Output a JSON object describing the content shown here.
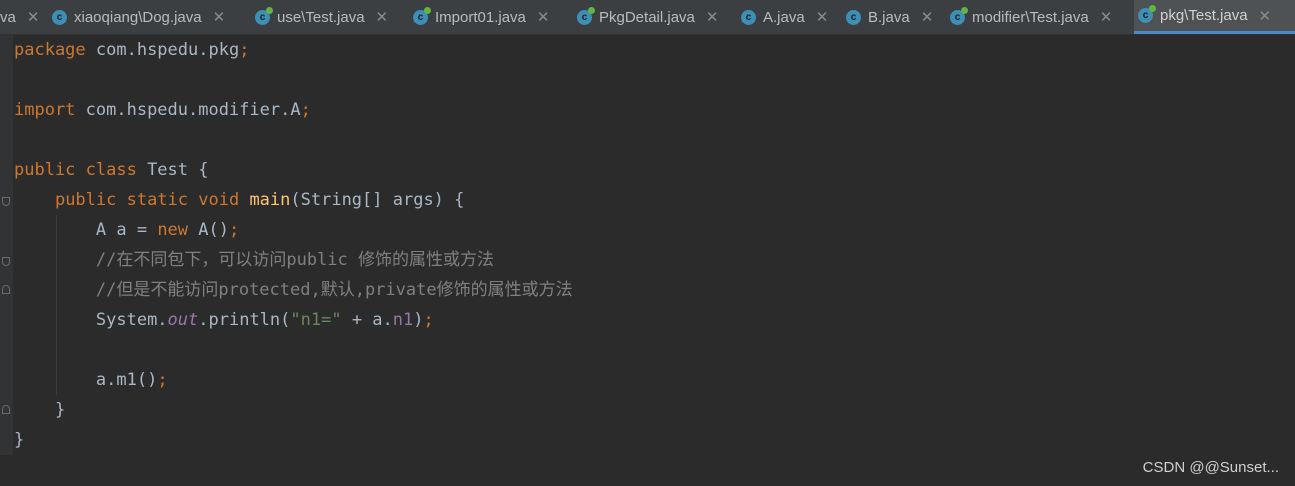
{
  "tabs": [
    {
      "label": "va",
      "icon": "none",
      "active": false
    },
    {
      "label": "xiaoqiang\\Dog.java",
      "icon": "java-class-icon",
      "active": false
    },
    {
      "label": "use\\Test.java",
      "icon": "java-runnable-class-icon",
      "active": false
    },
    {
      "label": "Import01.java",
      "icon": "java-runnable-class-icon",
      "active": false
    },
    {
      "label": "PkgDetail.java",
      "icon": "java-runnable-class-icon",
      "active": false
    },
    {
      "label": "A.java",
      "icon": "java-class-icon",
      "active": false
    },
    {
      "label": "B.java",
      "icon": "java-class-icon",
      "active": false
    },
    {
      "label": "modifier\\Test.java",
      "icon": "java-runnable-class-icon",
      "active": false
    },
    {
      "label": "pkg\\Test.java",
      "icon": "java-runnable-class-icon",
      "active": true
    }
  ],
  "close_glyph": "✕",
  "icon_letter": "c",
  "code": {
    "l1": {
      "kw": "package",
      "rest": " com.hspedu.pkg",
      "semi": ";"
    },
    "l2": {
      "kw": "import",
      "rest": " com.hspedu.modifier.A",
      "semi": ";"
    },
    "l3": {
      "kw": "public class",
      "rest": " Test {"
    },
    "l4": {
      "indent": "    ",
      "kw": "public static void",
      "sp": " ",
      "mth": "main",
      "rest": "(String[] args) {"
    },
    "l5": {
      "indent": "        ",
      "pre": "A a = ",
      "kw": "new",
      "post": " A()",
      "semi": ";"
    },
    "l6": {
      "indent": "        ",
      "comment": "//在不同包下，可以访问public 修饰的属性或方法"
    },
    "l7": {
      "indent": "        ",
      "comment": "//但是不能访问protected,默认,private修饰的属性或方法"
    },
    "l8": {
      "indent": "        ",
      "pre": "System.",
      "sfld": "out",
      "mid": ".println(",
      "str": "\"n1=\"",
      "plus": " + a.",
      "fld": "n1",
      "close": ")",
      "semi": ";"
    },
    "l9": {
      "indent": "        ",
      "pre": "a.m1()",
      "semi": ";"
    },
    "l10": {
      "indent": "    ",
      "text": "}"
    },
    "l11": {
      "text": "}"
    }
  },
  "watermark": "CSDN @@Sunset..."
}
